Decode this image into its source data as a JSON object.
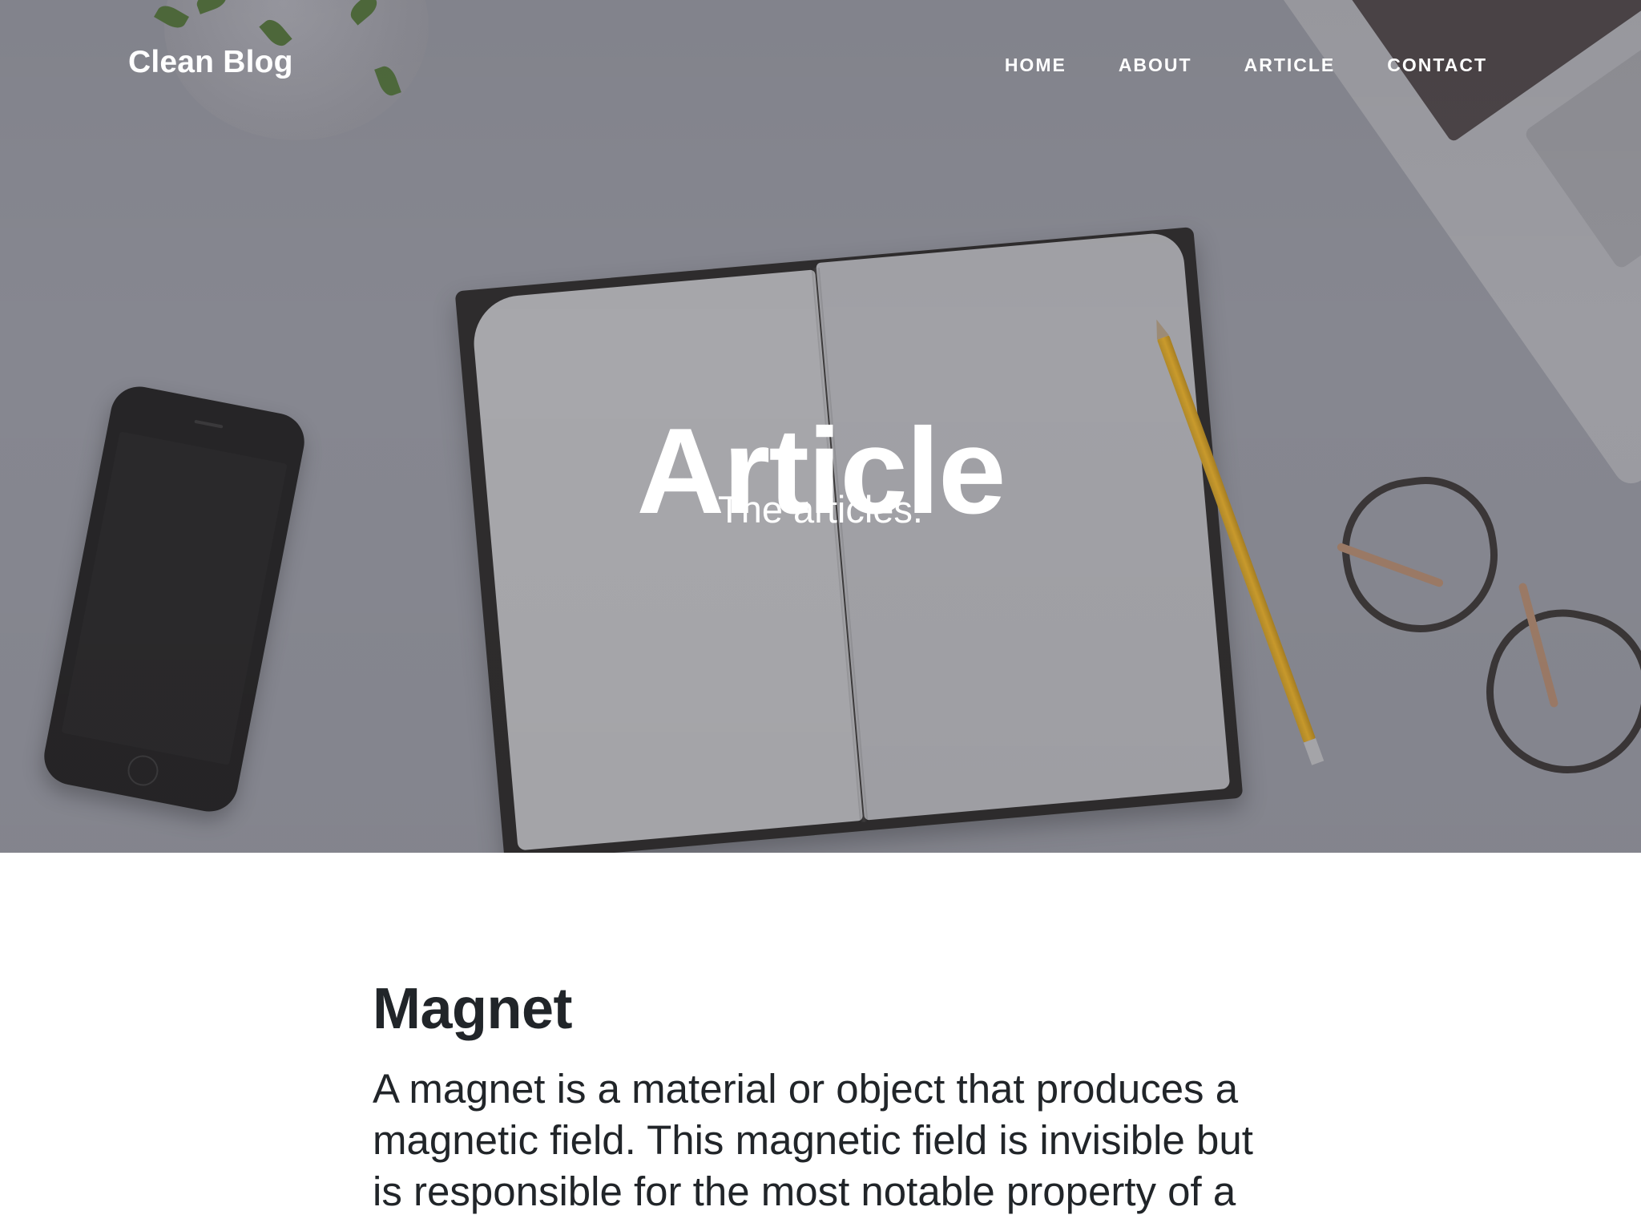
{
  "nav": {
    "brand": "Clean Blog",
    "links": [
      "HOME",
      "ABOUT",
      "ARTICLE",
      "CONTACT"
    ]
  },
  "hero": {
    "title": "Article",
    "subtitle": "The articles."
  },
  "post": {
    "title": "Magnet",
    "body": "A magnet is a material or object that produces a magnetic field. This magnetic field is invisible but is responsible for the most notable property of a"
  }
}
